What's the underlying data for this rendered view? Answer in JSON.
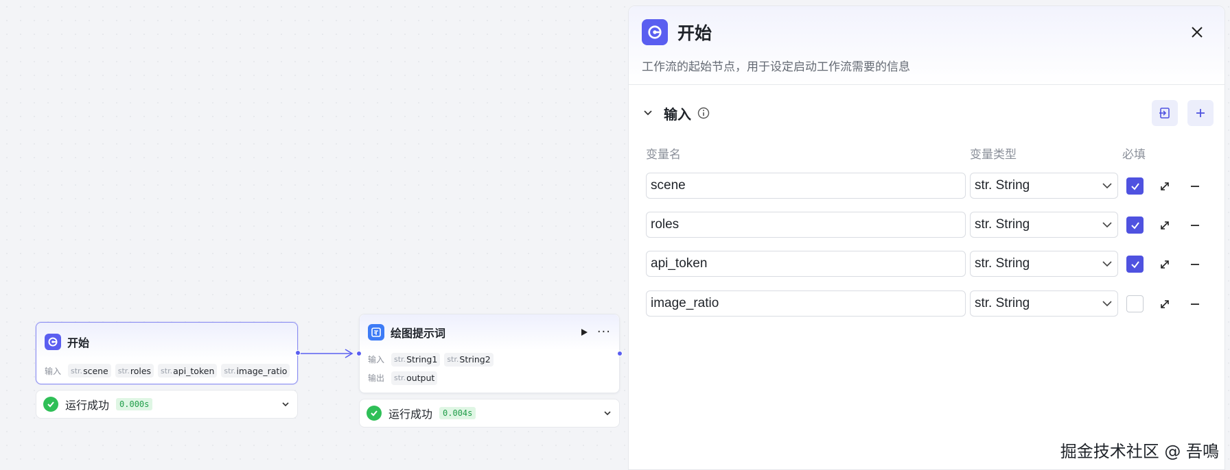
{
  "canvas": {
    "start_node": {
      "title": "开始",
      "input_label": "输入",
      "inputs": [
        {
          "type": "str.",
          "name": "scene"
        },
        {
          "type": "str.",
          "name": "roles"
        },
        {
          "type": "str.",
          "name": "api_token"
        },
        {
          "type": "str.",
          "name": "image_ratio"
        }
      ],
      "status": {
        "text": "运行成功",
        "time": "0.000s"
      }
    },
    "prompt_node": {
      "title": "绘图提示词",
      "input_label": "输入",
      "output_label": "输出",
      "inputs": [
        {
          "type": "str.",
          "name": "String1"
        },
        {
          "type": "str.",
          "name": "String2"
        }
      ],
      "outputs": [
        {
          "type": "str.",
          "name": "output"
        }
      ],
      "status": {
        "text": "运行成功",
        "time": "0.004s"
      }
    }
  },
  "panel": {
    "title": "开始",
    "description": "工作流的起始节点，用于设定启动工作流需要的信息",
    "section_title": "输入",
    "columns": {
      "name": "变量名",
      "type": "变量类型",
      "required": "必填"
    },
    "variables": [
      {
        "name": "scene",
        "type": "str. String",
        "required": true
      },
      {
        "name": "roles",
        "type": "str. String",
        "required": true
      },
      {
        "name": "api_token",
        "type": "str. String",
        "required": true
      },
      {
        "name": "image_ratio",
        "type": "str. String",
        "required": false
      }
    ]
  },
  "watermark": "掘金技术社区 @ 吾鳴",
  "colors": {
    "accent": "#5a5ef0",
    "checkbox": "#4f52e0",
    "success": "#2fbf57",
    "badge_bg": "#dff6e4"
  }
}
